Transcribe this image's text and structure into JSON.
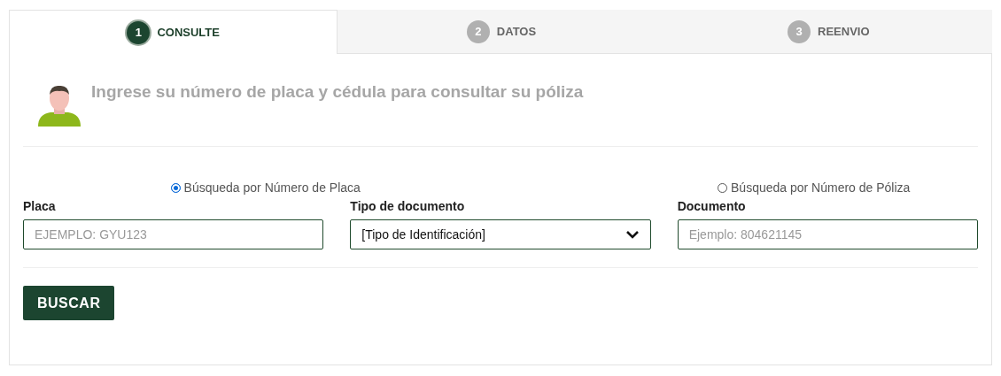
{
  "steps": [
    {
      "number": "1",
      "label": "CONSULTE",
      "selected": true
    },
    {
      "number": "2",
      "label": "DATOS",
      "selected": false
    },
    {
      "number": "3",
      "label": "REENVIO",
      "selected": false
    }
  ],
  "heading": "Ingrese su número de placa y cédula para consultar su póliza",
  "search_modes": [
    {
      "label": "Búsqueda por Número de Placa",
      "selected": true
    },
    {
      "label": "Búsqueda por Número de Póliza",
      "selected": false
    }
  ],
  "fields": [
    {
      "kind": "input",
      "label": "Placa",
      "placeholder": "EJEMPLO: GYU123"
    },
    {
      "kind": "select",
      "label": "Tipo de documento",
      "value": "[Tipo de Identificación]"
    },
    {
      "kind": "input",
      "label": "Documento",
      "placeholder": "Ejemplo: 804621145"
    }
  ],
  "submit_button": "BUSCAR"
}
